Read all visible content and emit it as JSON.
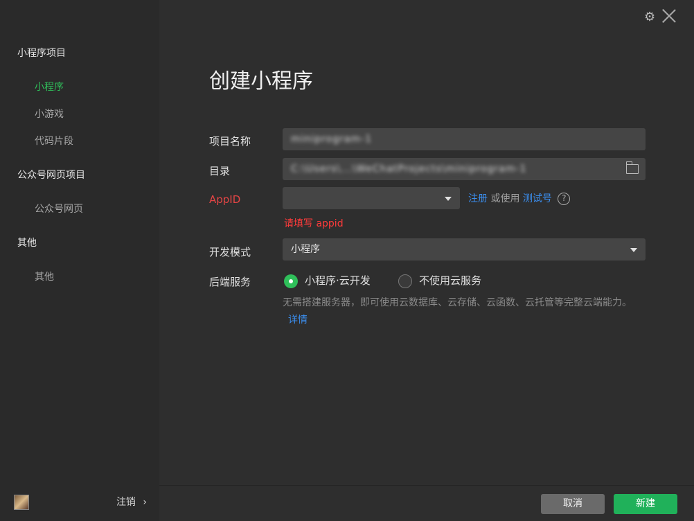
{
  "sidebar": {
    "sections": [
      {
        "title": "小程序项目",
        "items": [
          {
            "label": "小程序"
          },
          {
            "label": "小游戏"
          },
          {
            "label": "代码片段"
          }
        ]
      },
      {
        "title": "公众号网页项目",
        "items": [
          {
            "label": "公众号网页"
          }
        ]
      },
      {
        "title": "其他",
        "items": [
          {
            "label": "其他"
          }
        ]
      }
    ],
    "logout_label": "注销",
    "logout_chevron": "›"
  },
  "header": {
    "title": "创建小程序",
    "gear_icon": "gear-icon",
    "close_icon": "close-icon"
  },
  "form": {
    "project_name": {
      "label": "项目名称",
      "value": "miniprogram-1"
    },
    "directory": {
      "label": "目录",
      "value": "C:\\Users\\...\\WeChatProjects\\miniprogram-1"
    },
    "appid": {
      "label": "AppID",
      "value": "",
      "register_label": "注册",
      "or_use_label": "或使用",
      "test_label": "测试号",
      "help_glyph": "?",
      "error": "请填写 appid"
    },
    "dev_mode": {
      "label": "开发模式",
      "value": "小程序"
    },
    "backend": {
      "label": "后端服务",
      "options": [
        {
          "label": "小程序·云开发",
          "selected": true
        },
        {
          "label": "不使用云服务",
          "selected": false
        }
      ],
      "description": "无需搭建服务器，即可使用云数据库、云存储、云函数、云托管等完整云端能力。",
      "details_link": "详情"
    }
  },
  "buttons": {
    "cancel": "取消",
    "create": "新建"
  },
  "colors": {
    "accent_green": "#20b15a",
    "link_blue": "#3b8ff0",
    "error_red": "#ff3b3b",
    "label_red": "#e54545"
  }
}
